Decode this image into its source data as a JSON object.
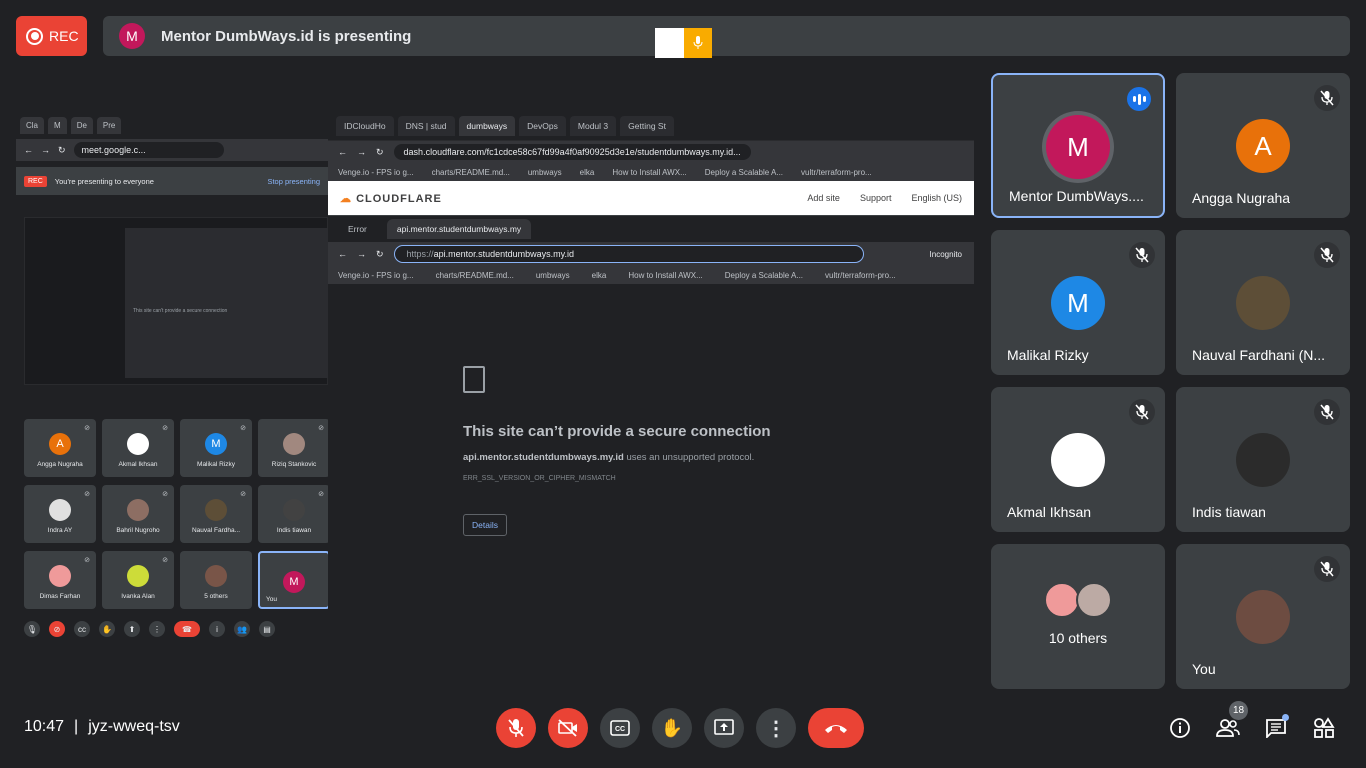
{
  "rec": {
    "label": "REC"
  },
  "presenting": {
    "avatar_letter": "M",
    "text": "Mentor DumbWays.id is presenting"
  },
  "shared_screen": {
    "left_window": {
      "tabs": [
        "Cla",
        "M",
        "De",
        "Pre"
      ],
      "url": "meet.google.c...",
      "banner_rec": "REC",
      "banner_text": "You're presenting to everyone",
      "stop_label": "Stop presenting",
      "mini_error": "This site can't provide a secure connection",
      "tiles": [
        {
          "name": "Angga Nugraha",
          "letter": "A",
          "color": "#e8710a"
        },
        {
          "name": "Akmal Ikhsan",
          "letter": "",
          "color": "#ffffff"
        },
        {
          "name": "Malikal Rizky",
          "letter": "M",
          "color": "#1e88e5"
        },
        {
          "name": "Riziq Stankovic",
          "letter": "",
          "color": "#a1887f"
        },
        {
          "name": "Indra AY",
          "letter": "",
          "color": "#e0e0e0"
        },
        {
          "name": "Bahril Nugroho",
          "letter": "",
          "color": "#8d6e63"
        },
        {
          "name": "Nauval Fardha...",
          "letter": "",
          "color": "#5d4e37"
        },
        {
          "name": "Indis tiawan",
          "letter": "",
          "color": "#424242"
        },
        {
          "name": "Dimas Farhan",
          "letter": "",
          "color": "#ef9a9a"
        },
        {
          "name": "Ivanka Alan",
          "letter": "",
          "color": "#cddc39"
        },
        {
          "name": "5 others",
          "letter": "",
          "color": "#795548"
        },
        {
          "name": "You",
          "letter": "M",
          "color": "#c2185b"
        }
      ]
    },
    "right_window": {
      "tabs": [
        "IDCloudHo",
        "DNS | stud",
        "dumbways",
        "DevOps",
        "Modul 3",
        "Getting St"
      ],
      "url": "dash.cloudflare.com/fc1cdce58c67fd99a4f0af90925d3e1e/studentdumbways.my.id...",
      "bookmarks": [
        "Venge.io - FPS io g...",
        "charts/README.md...",
        "umbways",
        "elka",
        "How to Install AWX...",
        "Deploy a Scalable A...",
        "vultr/terraform-pro..."
      ],
      "cf_logo": "CLOUDFLARE",
      "cf_add_site": "Add site",
      "cf_support": "Support",
      "cf_lang": "English (US)",
      "incognito": {
        "tabs": [
          "Error",
          "api.mentor.studentdumbways.my"
        ],
        "url_prefix": "https://",
        "url_host": "api.mentor.studentdumbways.my.id",
        "incognito_label": "Incognito",
        "bookmarks": [
          "Venge.io - FPS io g...",
          "charts/README.md...",
          "umbways",
          "elka",
          "How to Install AWX...",
          "Deploy a Scalable A...",
          "vultr/terraform-pro..."
        ],
        "error_title": "This site can’t provide a secure connection",
        "error_host": "api.mentor.studentdumbways.my.id",
        "error_desc": "uses an unsupported protocol.",
        "error_code": "ERR_SSL_VERSION_OR_CIPHER_MISMATCH",
        "details_label": "Details"
      }
    }
  },
  "participants": [
    {
      "name": "Mentor DumbWays....",
      "letter": "M",
      "color": "#c2185b",
      "speaking": true
    },
    {
      "name": "Angga Nugraha",
      "letter": "A",
      "color": "#e8710a",
      "muted": true
    },
    {
      "name": "Malikal Rizky",
      "letter": "M",
      "color": "#1e88e5",
      "muted": true
    },
    {
      "name": "Nauval Fardhani (N...",
      "letter": "",
      "color": "#5d4e37",
      "muted": true
    },
    {
      "name": "Akmal Ikhsan",
      "letter": "",
      "color": "#ffffff",
      "muted": true
    },
    {
      "name": "Indis tiawan",
      "letter": "",
      "color": "#2b2b2b",
      "muted": true
    },
    {
      "name": "10 others",
      "letter": "",
      "color": "#3c4043"
    },
    {
      "name": "You",
      "letter": "",
      "color": "#6d4c41",
      "muted": true
    }
  ],
  "footer": {
    "time": "10:47",
    "separator": "|",
    "meeting_code": "jyz-wweq-tsv",
    "people_count": "18"
  }
}
